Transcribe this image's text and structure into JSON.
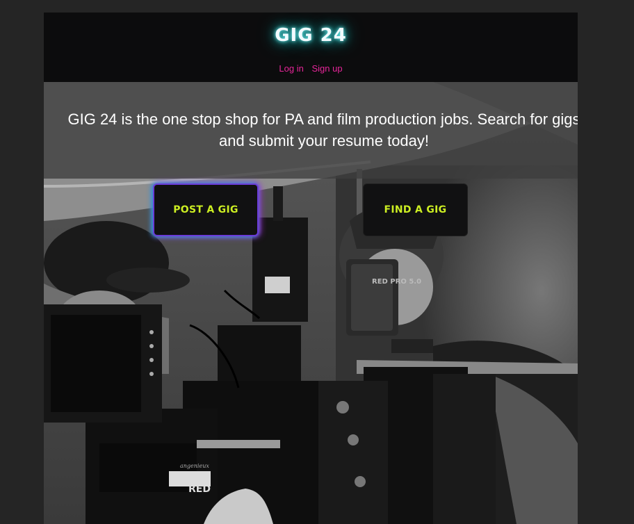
{
  "header": {
    "logo": "GIG 24",
    "nav": [
      {
        "label": "Log in"
      },
      {
        "label": "Sign up"
      }
    ]
  },
  "hero": {
    "tagline": "GIG 24 is the one stop shop for PA and film production jobs. Search for gigs and submit your resume today!",
    "image_labels": {
      "monitor": "RED PRO 5.0",
      "camera": "RED",
      "brand": "angenieux"
    },
    "buttons": {
      "post": "POST A GIG",
      "find": "FIND A GIG"
    }
  },
  "colors": {
    "page_background": "#252525",
    "header_background": "#0c0c0d",
    "logo_glow": "#22cccc",
    "nav_link": "#e8259a",
    "button_text": "#ccee22",
    "button_background": "#111112"
  }
}
